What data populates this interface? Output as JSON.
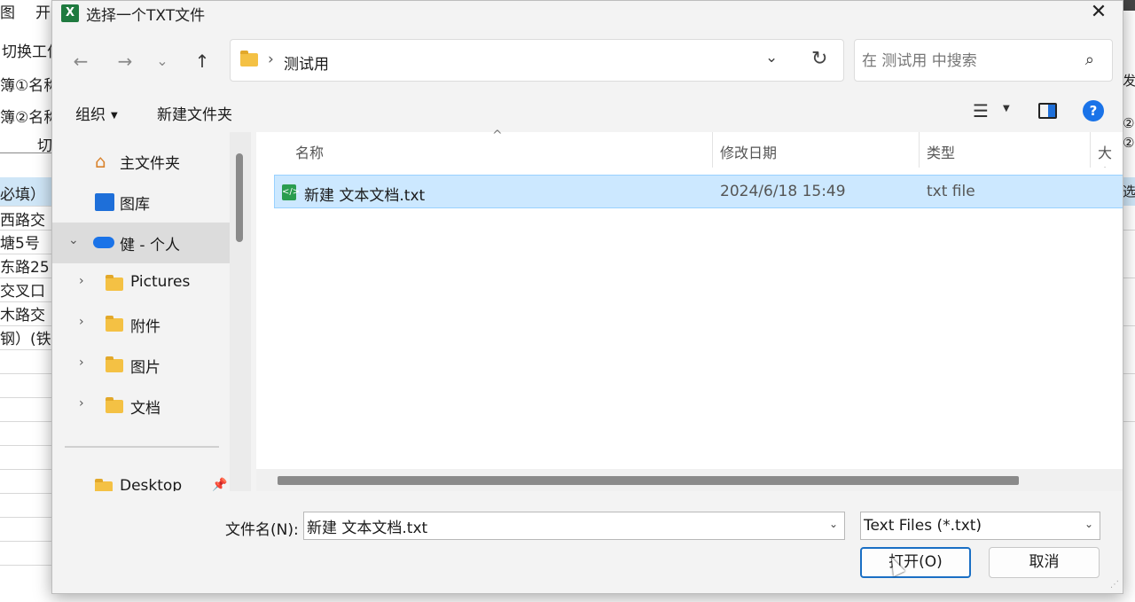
{
  "background_app": {
    "menu_fragments": [
      "图",
      "开"
    ],
    "left_fragments": [
      "切换工作",
      "簿①名称",
      "簿②名称",
      "切",
      "必填）",
      "西路交",
      "塘5号",
      "东路25",
      "交叉口",
      "木路交",
      "钢）(铁"
    ],
    "right_fragments": [
      "②",
      "发生",
      "②",
      "选"
    ]
  },
  "dialog": {
    "title": "选择一个TXT文件",
    "close_glyph": "✕",
    "nav": {
      "back": "←",
      "forward": "→",
      "recent": "⌄",
      "up": "↑"
    },
    "address": {
      "separator": "›",
      "current_folder": "测试用",
      "history": "⌄",
      "refresh": "↻"
    },
    "search": {
      "placeholder": "在 测试用 中搜索",
      "icon": "search-icon"
    },
    "toolbar": {
      "organize": "组织",
      "new_folder": "新建文件夹"
    },
    "nav_pane": {
      "items": [
        {
          "label": "主文件夹",
          "icon": "home-icon",
          "expandable": false,
          "selected": false
        },
        {
          "label": "图库",
          "icon": "gallery-icon",
          "expandable": false,
          "selected": false
        },
        {
          "label": "健 - 个人",
          "icon": "onedrive-icon",
          "expandable": true,
          "expanded": true,
          "selected": true
        },
        {
          "label": "Pictures",
          "icon": "folder-icon",
          "expandable": true,
          "selected": false
        },
        {
          "label": "附件",
          "icon": "folder-icon",
          "expandable": true,
          "selected": false
        },
        {
          "label": "图片",
          "icon": "folder-icon",
          "expandable": true,
          "selected": false
        },
        {
          "label": "文档",
          "icon": "folder-icon",
          "expandable": true,
          "selected": false
        },
        {
          "label": "Desktop",
          "icon": "folder-icon",
          "expandable": false,
          "selected": false,
          "pinned": true
        }
      ]
    },
    "file_list": {
      "columns": [
        "名称",
        "修改日期",
        "类型",
        "大小"
      ],
      "rows": [
        {
          "name": "新建 文本文档.txt",
          "modified": "2024/6/18 15:49",
          "type": "txt file",
          "selected": true
        }
      ]
    },
    "bottom": {
      "filename_label": "文件名(N):",
      "filename_value": "新建 文本文档.txt",
      "filter_value": "Text Files (*.txt)",
      "open_button": "打开(O)",
      "cancel_button": "取消"
    },
    "colors": {
      "selection": "#cce8ff",
      "selection_border": "#99d1ff",
      "accent": "#1a73e8",
      "folder": "#f4c144"
    }
  }
}
